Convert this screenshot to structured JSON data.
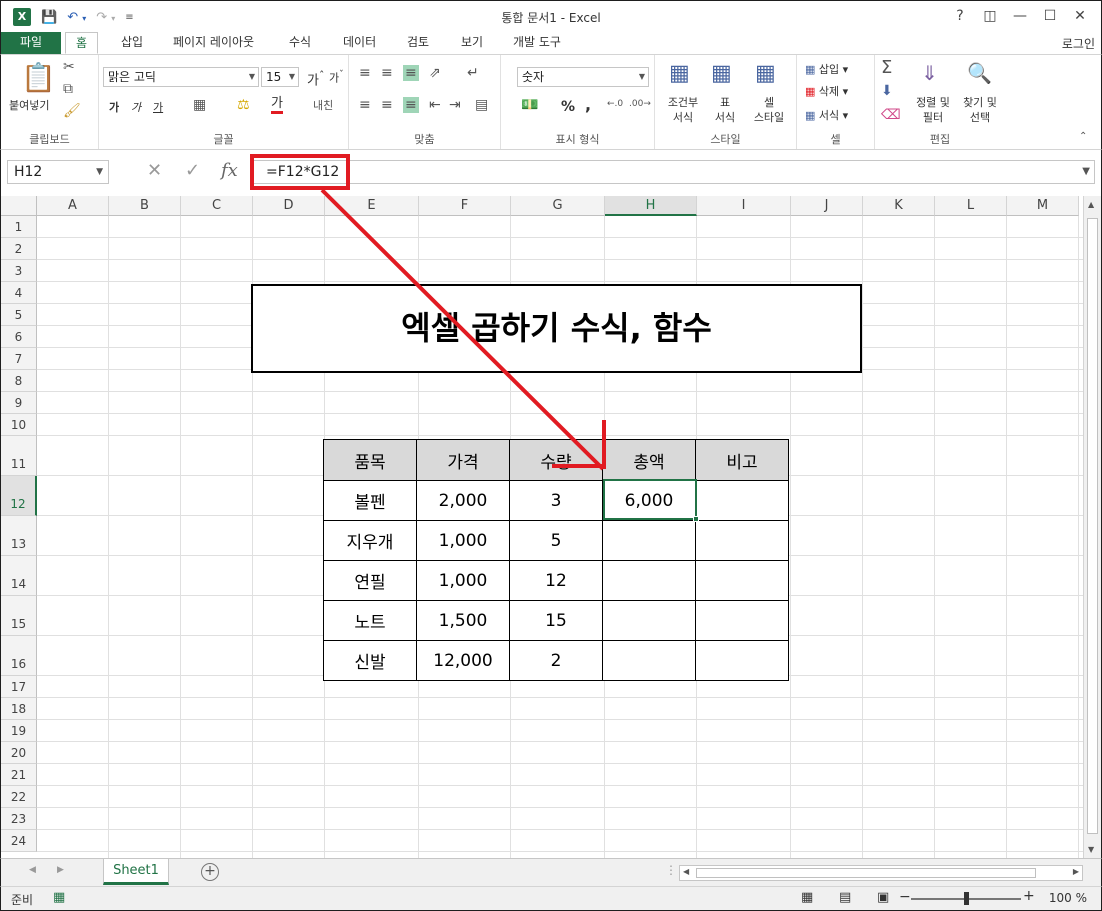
{
  "window": {
    "title": "통합 문서1 - Excel",
    "help": "?",
    "controls": [
      "⊡",
      "—",
      "☐",
      "✕"
    ]
  },
  "qat": [
    "💾",
    "↶",
    "↷"
  ],
  "tabs": [
    "파일",
    "홈",
    "삽입",
    "페이지 레이아웃",
    "수식",
    "데이터",
    "검토",
    "보기",
    "개발 도구"
  ],
  "login": "로그인",
  "ribbon": {
    "clipboard": {
      "paste": "붙여넣기",
      "label": "클립보드"
    },
    "font": {
      "name": "맑은 고딕",
      "size": "15",
      "label": "글꼴",
      "bold": "가",
      "italic": "가",
      "underline": "가",
      "grow": "가",
      "shrink": "가",
      "color_char": "가"
    },
    "align": {
      "label": "맞춤"
    },
    "number": {
      "format": "숫자",
      "percent": "%",
      "comma": ",",
      "label": "표시 형식"
    },
    "styles": {
      "cond": "조건부\n서식",
      "cond1": "조건부",
      "cond2": "서식",
      "table1": "표",
      "table2": "서식",
      "cell1": "셀",
      "cell2": "스타일",
      "label": "스타일"
    },
    "cells": {
      "insert": "삽입",
      "delete": "삭제",
      "format": "서식",
      "label": "셀"
    },
    "edit": {
      "sort1": "정렬 및",
      "sort2": "필터",
      "find1": "찾기 및",
      "find2": "선택",
      "label": "편집"
    }
  },
  "formula_bar": {
    "name_box": "H12",
    "formula": "=F12*G12"
  },
  "columns": [
    "A",
    "B",
    "C",
    "D",
    "E",
    "F",
    "G",
    "H",
    "I",
    "J",
    "K",
    "L",
    "M"
  ],
  "rows": [
    "1",
    "2",
    "3",
    "4",
    "5",
    "6",
    "7",
    "8",
    "9",
    "10",
    "11",
    "12",
    "13",
    "14",
    "15",
    "16",
    "17",
    "18",
    "19",
    "20",
    "21",
    "22",
    "23",
    "24"
  ],
  "banner": "엑셀 곱하기 수식, 함수",
  "table": {
    "headers": [
      "품목",
      "가격",
      "수량",
      "총액",
      "비고"
    ],
    "rows": [
      [
        "볼펜",
        "2,000",
        "3",
        "6,000",
        ""
      ],
      [
        "지우개",
        "1,000",
        "5",
        "",
        ""
      ],
      [
        "연필",
        "1,000",
        "12",
        "",
        ""
      ],
      [
        "노트",
        "1,500",
        "15",
        "",
        ""
      ],
      [
        "신발",
        "12,000",
        "2",
        "",
        ""
      ]
    ]
  },
  "sheets": [
    "Sheet1"
  ],
  "status": {
    "ready": "준비",
    "zoom": "100 %"
  },
  "accent": "#217346",
  "annotation_color": "#e11b22"
}
